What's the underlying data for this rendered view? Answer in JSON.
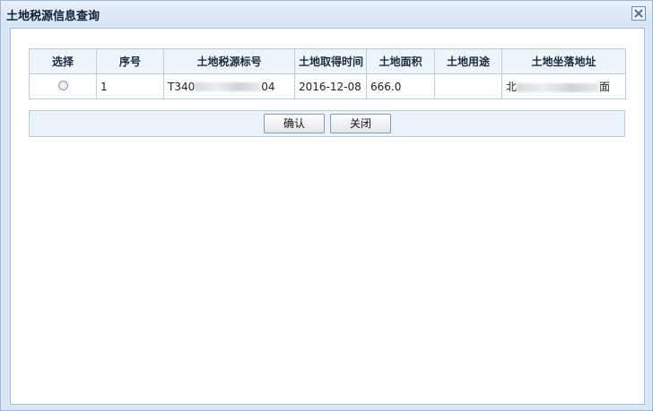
{
  "dialog": {
    "title": "土地税源信息查询",
    "close_icon": "close-icon"
  },
  "table": {
    "columns": [
      "选择",
      "序号",
      "土地税源标号",
      "土地取得时间",
      "土地面积",
      "土地用途",
      "土地坐落地址"
    ],
    "rows": [
      {
        "seq": "1",
        "id_prefix": "T340",
        "id_suffix": "04",
        "acquired": "2016-12-08",
        "area": "666.0",
        "usage": "",
        "addr_prefix": "北",
        "addr_suffix": "面"
      }
    ]
  },
  "buttons": {
    "confirm": "确认",
    "close": "关闭"
  },
  "colors": {
    "accent": "#dbe6f4",
    "border": "#b8cde2",
    "header_bg": "#eef4fb"
  }
}
